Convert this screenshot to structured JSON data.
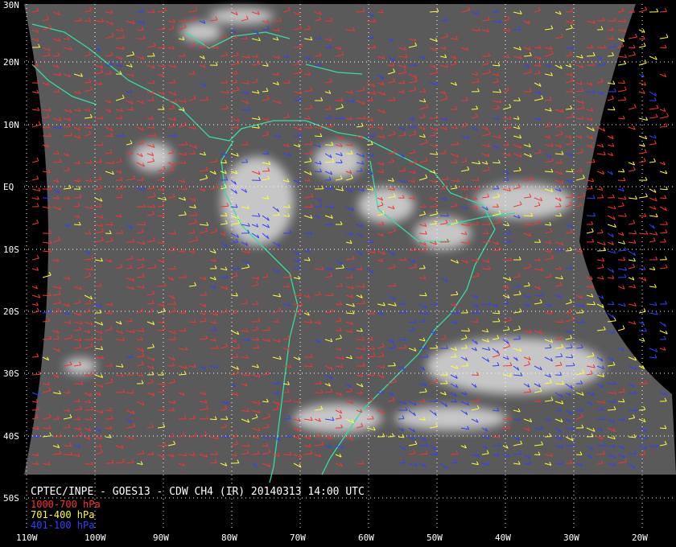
{
  "title": "CPTEC/INPE - GOES13 - CDW CH4 (IR) 20140313 14:00 UTC",
  "legend": [
    {
      "label": "1000-700 hPa",
      "color": "#ff3030"
    },
    {
      "label": "701-400 hPa",
      "color": "#ffff30"
    },
    {
      "label": "401-100 hPa",
      "color": "#3040ff"
    }
  ],
  "lat_labels": [
    "30N",
    "20N",
    "10N",
    "EQ",
    "10S",
    "20S",
    "30S",
    "40S",
    "50S"
  ],
  "lon_labels": [
    "110W",
    "100W",
    "90W",
    "80W",
    "70W",
    "60W",
    "50W",
    "40W",
    "30W",
    "20W"
  ],
  "colors": {
    "coast": "#30e0a0",
    "grid": "#ffffff",
    "background": "#000000"
  }
}
